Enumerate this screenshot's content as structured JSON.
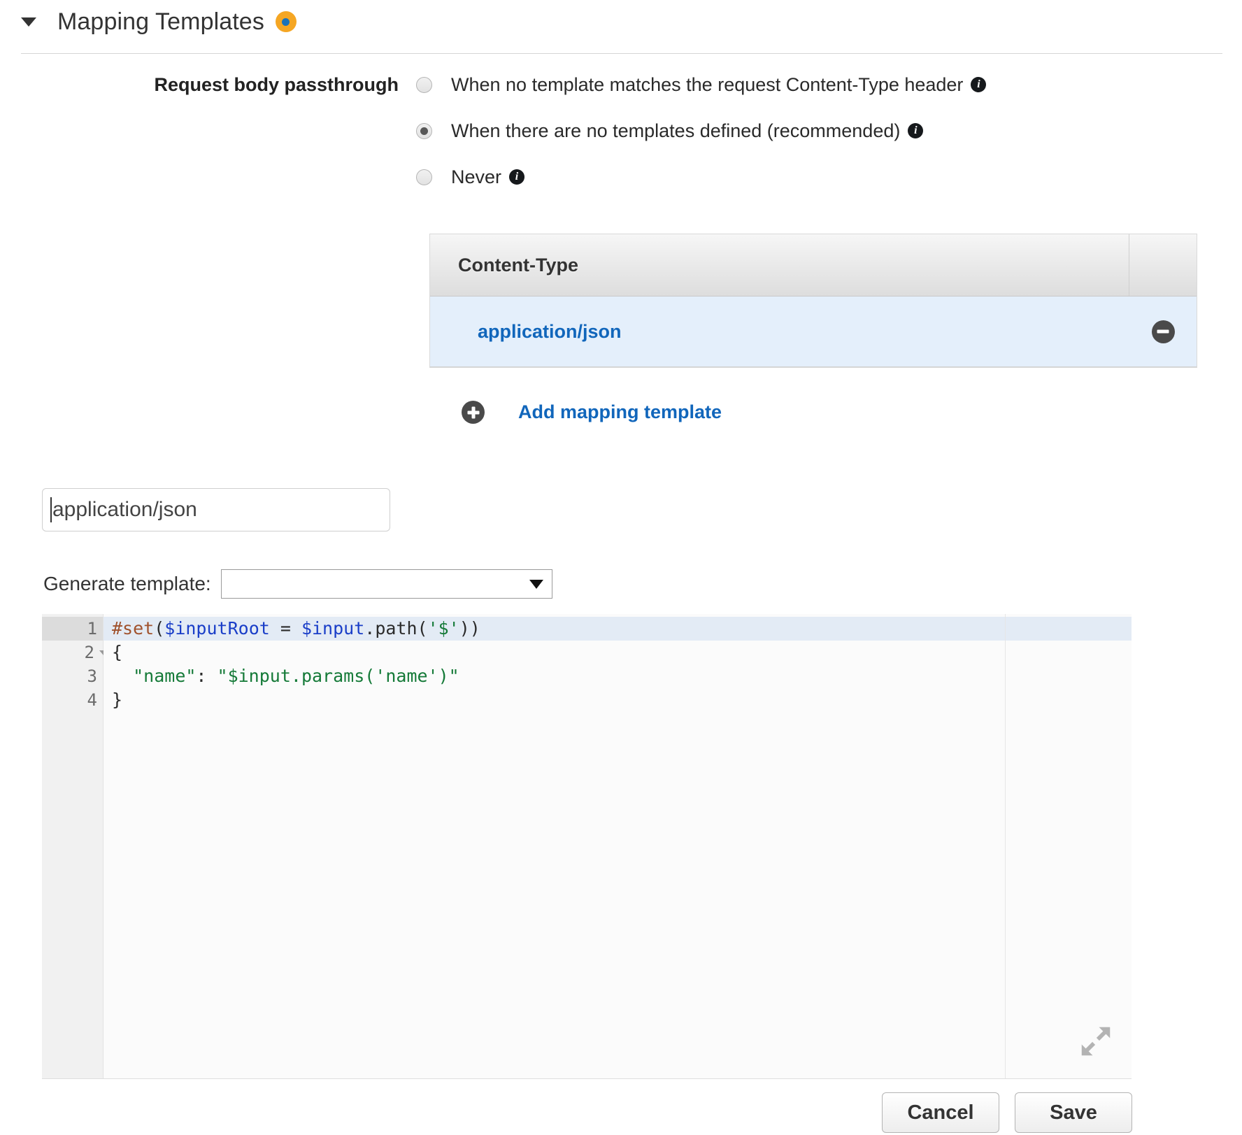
{
  "section": {
    "title": "Mapping Templates",
    "collapse_icon": "caret-down-icon",
    "cursor_badge_icon": "cursor-target-icon",
    "expanded": true
  },
  "request_body_passthrough": {
    "label": "Request body passthrough",
    "options": [
      {
        "label": "When no template matches the request Content-Type header",
        "selected": false,
        "info_icon": "info-icon"
      },
      {
        "label": "When there are no templates defined (recommended)",
        "selected": true,
        "info_icon": "info-icon"
      },
      {
        "label": "Never",
        "selected": false,
        "info_icon": "info-icon"
      }
    ]
  },
  "content_type_table": {
    "columns": [
      "Content-Type",
      ""
    ],
    "rows": [
      {
        "content_type": "application/json",
        "remove_icon": "minus-circle-icon",
        "selected": true
      }
    ],
    "add_link": {
      "label": "Add mapping template",
      "icon": "plus-circle-icon"
    }
  },
  "template_editor": {
    "content_type_input": {
      "value": "application/json",
      "placeholder": ""
    },
    "generate_template": {
      "label": "Generate template:",
      "selected": "",
      "placeholder": "",
      "caret_icon": "chevron-down-icon",
      "options": []
    },
    "code": {
      "lines": [
        {
          "number": "1",
          "active": true,
          "foldable": false,
          "tokens": [
            {
              "t": "#set",
              "c": "kw"
            },
            {
              "t": "(",
              "c": "op"
            },
            {
              "t": "$inputRoot",
              "c": "var"
            },
            {
              "t": " = ",
              "c": "op"
            },
            {
              "t": "$input",
              "c": "var"
            },
            {
              "t": ".path(",
              "c": "op"
            },
            {
              "t": "'$'",
              "c": "str"
            },
            {
              "t": "))",
              "c": "op"
            }
          ]
        },
        {
          "number": "2",
          "active": false,
          "foldable": true,
          "tokens": [
            {
              "t": "{",
              "c": "op"
            }
          ]
        },
        {
          "number": "3",
          "active": false,
          "foldable": false,
          "tokens": [
            {
              "t": "  ",
              "c": "op"
            },
            {
              "t": "\"name\"",
              "c": "str"
            },
            {
              "t": ": ",
              "c": "op"
            },
            {
              "t": "\"$input.params('name')\"",
              "c": "str"
            }
          ]
        },
        {
          "number": "4",
          "active": false,
          "foldable": false,
          "tokens": [
            {
              "t": "}",
              "c": "op"
            }
          ]
        }
      ]
    },
    "expand_icon": "expand-diagonal-icon"
  },
  "footer": {
    "cancel_label": "Cancel",
    "save_label": "Save"
  },
  "colors": {
    "link": "#1166bb",
    "selected_row": "#e4effb",
    "badge_orange": "#f5a623",
    "badge_blue": "#1b72b8",
    "icon_dark": "#4a4a4a"
  }
}
